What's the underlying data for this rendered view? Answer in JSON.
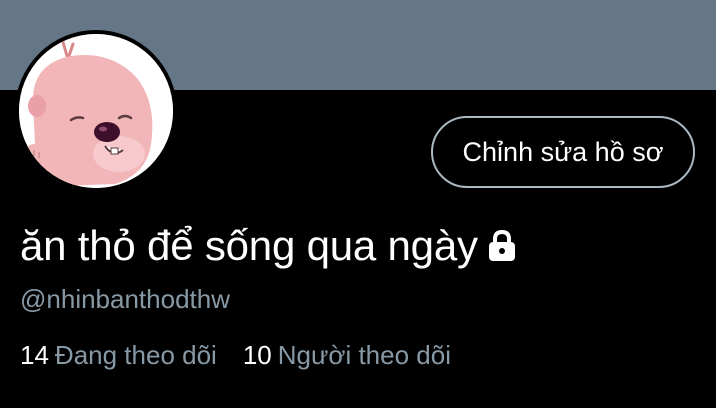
{
  "profile": {
    "display_name": "ăn thỏ để sống qua ngày",
    "handle": "@nhinbanthodthw",
    "edit_button_label": "Chỉnh sửa hồ sơ",
    "is_protected": true
  },
  "stats": {
    "following_count": "14",
    "following_label": "Đang theo dõi",
    "followers_count": "10",
    "followers_label": "Người theo dõi"
  },
  "colors": {
    "banner": "#657786",
    "background": "#000000",
    "secondary_text": "#8899a6",
    "button_border": "#aab8c2"
  },
  "icons": {
    "lock": "lock-icon",
    "avatar": "pink-beaver-avatar"
  }
}
